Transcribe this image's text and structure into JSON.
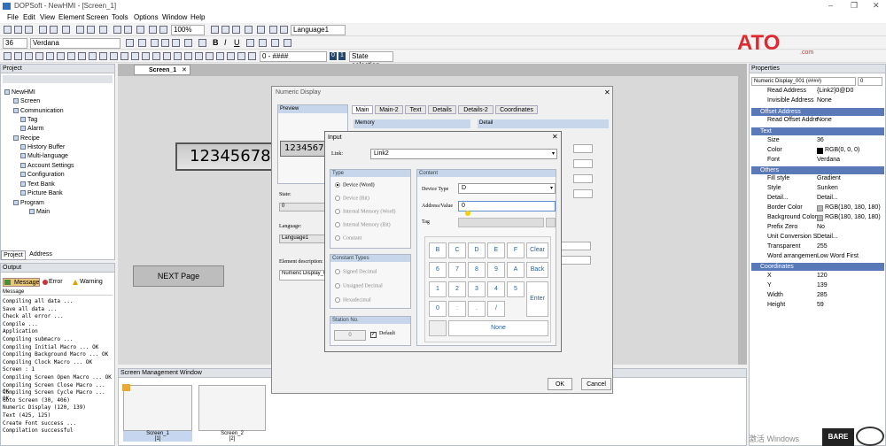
{
  "app": {
    "title": "DOPSoft - NewHMI - [Screen_1]"
  },
  "menu": [
    "File",
    "Edit",
    "View",
    "Element",
    "Screen",
    "Tools",
    "Options",
    "Window",
    "Help"
  ],
  "toolbar": {
    "zoom": "100%",
    "language": "Language1",
    "font_size": "36",
    "font_name": "Verdana",
    "format_value": "0 - ####",
    "state_label": "State selection"
  },
  "brand": {
    "logo": "ATO",
    "logo_sub": ".com"
  },
  "project": {
    "header": "Project",
    "tree": [
      "NewHMI",
      "Screen",
      "Communication",
      "Tag",
      "Alarm",
      "Recipe",
      "History Buffer",
      "Multi-language",
      "Account Settings",
      "Configuration",
      "Text Bank",
      "Picture Bank",
      "Program",
      "Main"
    ],
    "tabs": [
      "Project",
      "Address"
    ]
  },
  "output": {
    "header": "Output",
    "filters": [
      "Message",
      "Error",
      "Warning"
    ],
    "col": "Message",
    "lines": [
      "Compiling all data ...",
      "Save all data ...",
      "Check all error ...",
      "Compile ...",
      "Application",
      "Compiling submacro ...",
      "Compiling Initial Macro ... OK",
      "Compiling Background Macro ... OK",
      "Compiling Clock Macro ... OK",
      "Screen : 1",
      "Compiling Screen Open Macro ... OK",
      "Compiling Screen Close Macro ... OK",
      "Compiling Screen Cycle Macro ... OK",
      "Goto Screen (30, 406)",
      "Numeric Display (120, 139)",
      "Text (425, 125)",
      "Create Font success ...",
      "Compilation successful"
    ]
  },
  "editor": {
    "tab": "Screen_1",
    "numeric_display": "12345678",
    "next_button": "NEXT Page"
  },
  "screen_mgmt": {
    "header": "Screen Management Window",
    "thumbs": [
      {
        "name": "Screen_1",
        "num": "[1]"
      },
      {
        "name": "Screen_2",
        "num": "[2]"
      }
    ]
  },
  "numeric_dialog": {
    "title": "Numeric Display",
    "preview_header": "Preview",
    "preview_value": "12345678",
    "tabs": [
      "Main",
      "Main-2",
      "Text",
      "Details",
      "Details-2",
      "Coordinates"
    ],
    "memory_header": "Memory",
    "detail_header": "Detail",
    "state_label": "State:",
    "state_value": "0",
    "language_label": "Language:",
    "language_value": "Language1",
    "element_desc_label": "Element description:",
    "element_desc_value": "Numeric Display_0",
    "ok": "OK",
    "cancel": "Cancel"
  },
  "input_dialog": {
    "title": "Input",
    "link_label": "Link:",
    "link_value": "Link2",
    "type_header": "Type",
    "types": [
      "Device (Word)",
      "Device (Bit)",
      "Internal Memory (Word)",
      "Internal Memory (Bit)",
      "Constant"
    ],
    "const_header": "Constant Types",
    "const_types": [
      "Signed Decimal",
      "Unsigned Decimal",
      "Hexadecimal"
    ],
    "station_header": "Station No.",
    "station_value": "0",
    "default_label": "Default",
    "content_header": "Content",
    "device_type_label": "Device Type",
    "device_type_value": "D",
    "address_label": "Address/Value",
    "address_value": "0",
    "tag_label": "Tag",
    "keys": [
      "B",
      "C",
      "D",
      "E",
      "F",
      "Clear",
      "6",
      "7",
      "8",
      "9",
      "A",
      "Back",
      "1",
      "2",
      "3",
      "4",
      "5",
      "Enter",
      "0",
      ":",
      ".",
      "/"
    ],
    "none_label": "None"
  },
  "properties": {
    "header": "Properties",
    "selector": "Numeric Display_001 (####)",
    "selector_num": "0",
    "rows_top": [
      {
        "k": "Read Address",
        "v": "{Link2}0@D0"
      },
      {
        "k": "Invisible Address",
        "v": "None"
      }
    ],
    "sections": [
      "Offset Address",
      "Text",
      "Others",
      "Coordinates"
    ],
    "offset": [
      {
        "k": "Read Offset Addre",
        "v": "None"
      }
    ],
    "text": [
      {
        "k": "Size",
        "v": "36"
      },
      {
        "k": "Color",
        "v": "RGB(0, 0, 0)"
      },
      {
        "k": "Font",
        "v": "Verdana"
      }
    ],
    "others": [
      {
        "k": "Fill style",
        "v": "Gradient"
      },
      {
        "k": "Style",
        "v": "Sunken"
      },
      {
        "k": "Detail...",
        "v": "Detail..."
      },
      {
        "k": "Border Color",
        "v": "RGB(180, 180, 180)"
      },
      {
        "k": "Background Color",
        "v": "RGB(180, 180, 180)"
      },
      {
        "k": "Prefix Zero",
        "v": "No"
      },
      {
        "k": "Unit Conversion S",
        "v": "Detail..."
      },
      {
        "k": "Transparent",
        "v": "255"
      },
      {
        "k": "Word arrangemen",
        "v": "Low Word First"
      }
    ],
    "coords": [
      {
        "k": "X",
        "v": "120"
      },
      {
        "k": "Y",
        "v": "139"
      },
      {
        "k": "Width",
        "v": "285"
      },
      {
        "k": "Height",
        "v": "59"
      }
    ]
  },
  "taskbar": {
    "windows_text": "激活 Windows",
    "watermark": "BARE"
  }
}
